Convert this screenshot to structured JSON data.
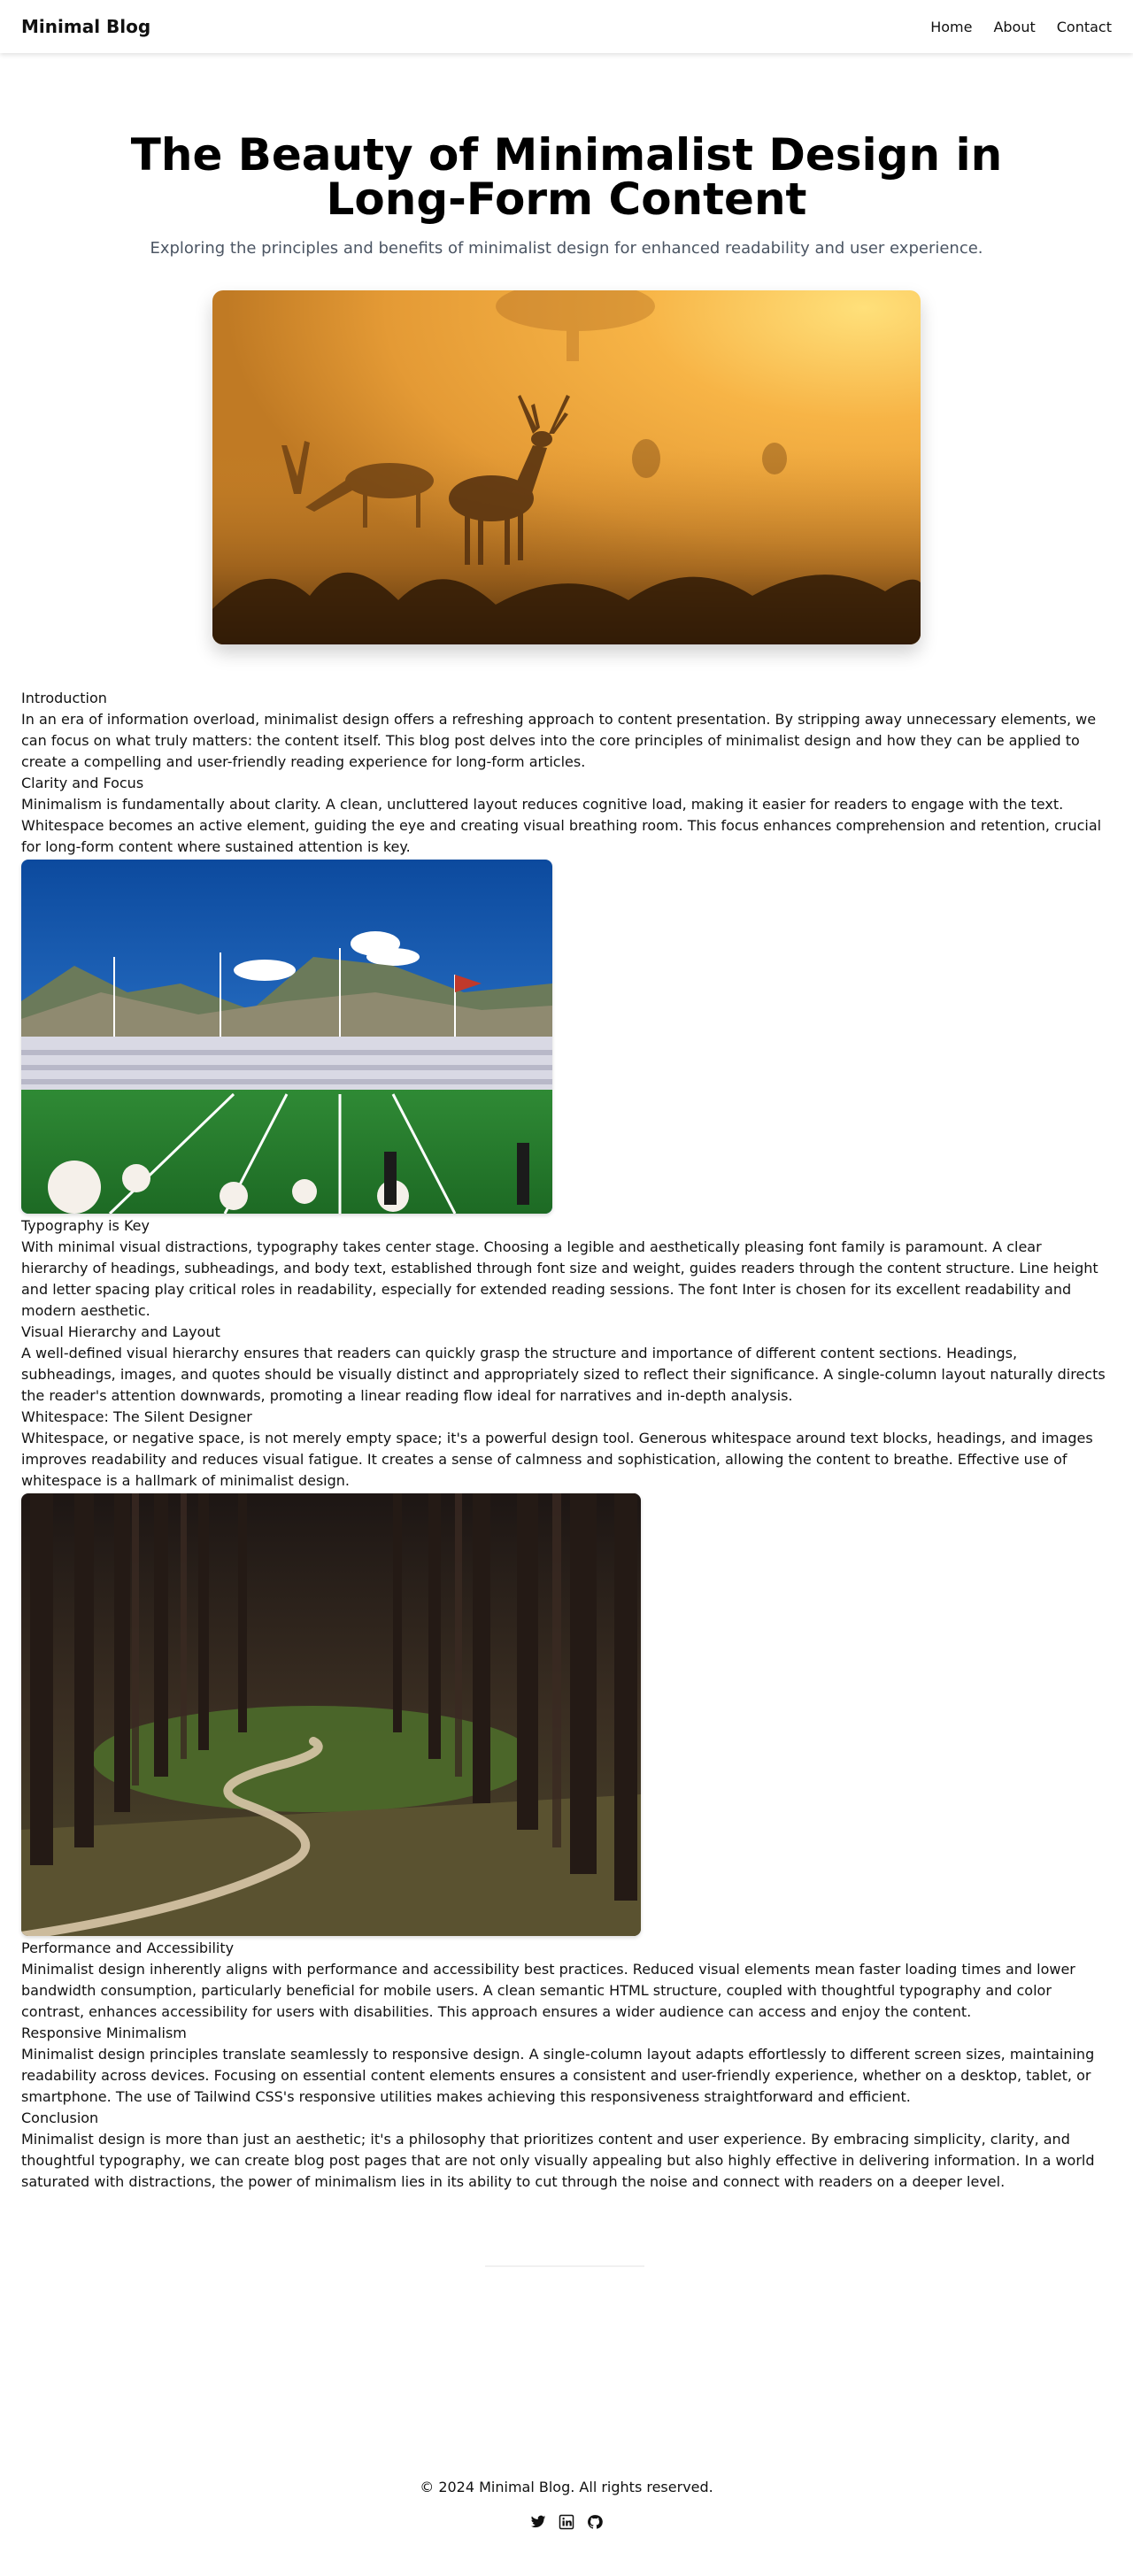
{
  "header": {
    "brand": "Minimal Blog",
    "nav": [
      "Home",
      "About",
      "Contact"
    ]
  },
  "hero": {
    "title": "The Beauty of Minimalist Design in Long-Form Content",
    "subtitle": "Exploring the principles and benefits of minimalist design for enhanced readability and user experience."
  },
  "article": {
    "intro_heading": "Introduction",
    "intro_text": "In an era of information overload, minimalist design offers a refreshing approach to content presentation. By stripping away unnecessary elements, we can focus on what truly matters: the content itself. This blog post delves into the core principles of minimalist design and how they can be applied to create a compelling and user-friendly reading experience for long-form articles.",
    "clarity_heading": "Clarity and Focus",
    "clarity_text": "Minimalism is fundamentally about clarity. A clean, uncluttered layout reduces cognitive load, making it easier for readers to engage with the text. Whitespace becomes an active element, guiding the eye and creating visual breathing room. This focus enhances comprehension and retention, crucial for long-form content where sustained attention is key.",
    "typography_heading": "Typography is Key",
    "typography_text": "With minimal visual distractions, typography takes center stage. Choosing a legible and aesthetically pleasing font family is paramount. A clear hierarchy of headings, subheadings, and body text, established through font size and weight, guides readers through the content structure. Line height and letter spacing play critical roles in readability, especially for extended reading sessions. The font Inter is chosen for its excellent readability and modern aesthetic.",
    "hierarchy_heading": "Visual Hierarchy and Layout",
    "hierarchy_text": "A well-defined visual hierarchy ensures that readers can quickly grasp the structure and importance of different content sections. Headings, subheadings, images, and quotes should be visually distinct and appropriately sized to reflect their significance. A single-column layout naturally directs the reader's attention downwards, promoting a linear reading flow ideal for narratives and in-depth analysis.",
    "whitespace_heading": "Whitespace: The Silent Designer",
    "whitespace_text": "Whitespace, or negative space, is not merely empty space; it's a powerful design tool. Generous whitespace around text blocks, headings, and images improves readability and reduces visual fatigue. It creates a sense of calmness and sophistication, allowing the content to breathe. Effective use of whitespace is a hallmark of minimalist design.",
    "performance_heading": "Performance and Accessibility",
    "performance_text": "Minimalist design inherently aligns with performance and accessibility best practices. Reduced visual elements mean faster loading times and lower bandwidth consumption, particularly beneficial for mobile users. A clean semantic HTML structure, coupled with thoughtful typography and color contrast, enhances accessibility for users with disabilities. This approach ensures a wider audience can access and enjoy the content.",
    "responsive_heading": "Responsive Minimalism",
    "responsive_text": "Minimalist design principles translate seamlessly to responsive design. A single-column layout adapts effortlessly to different screen sizes, maintaining readability across devices. Focusing on essential content elements ensures a consistent and user-friendly experience, whether on a desktop, tablet, or smartphone. The use of Tailwind CSS's responsive utilities makes achieving this responsiveness straightforward and efficient.",
    "conclusion_heading": "Conclusion",
    "conclusion_text": "Minimalist design is more than just an aesthetic; it's a philosophy that prioritizes content and user experience. By embracing simplicity, clarity, and thoughtful typography, we can create blog post pages that are not only visually appealing but also highly effective in delivering information. In a world saturated with distractions, the power of minimalism lies in its ability to cut through the noise and connect with readers on a deeper level."
  },
  "footer": {
    "copyright": "© 2024 Minimal Blog. All rights reserved.",
    "social_icons": [
      "twitter-icon",
      "linkedin-icon",
      "github-icon"
    ]
  },
  "colors": {
    "text": "#111111",
    "subtitle": "#4b5563",
    "hero_orange": "#f2a93b"
  }
}
